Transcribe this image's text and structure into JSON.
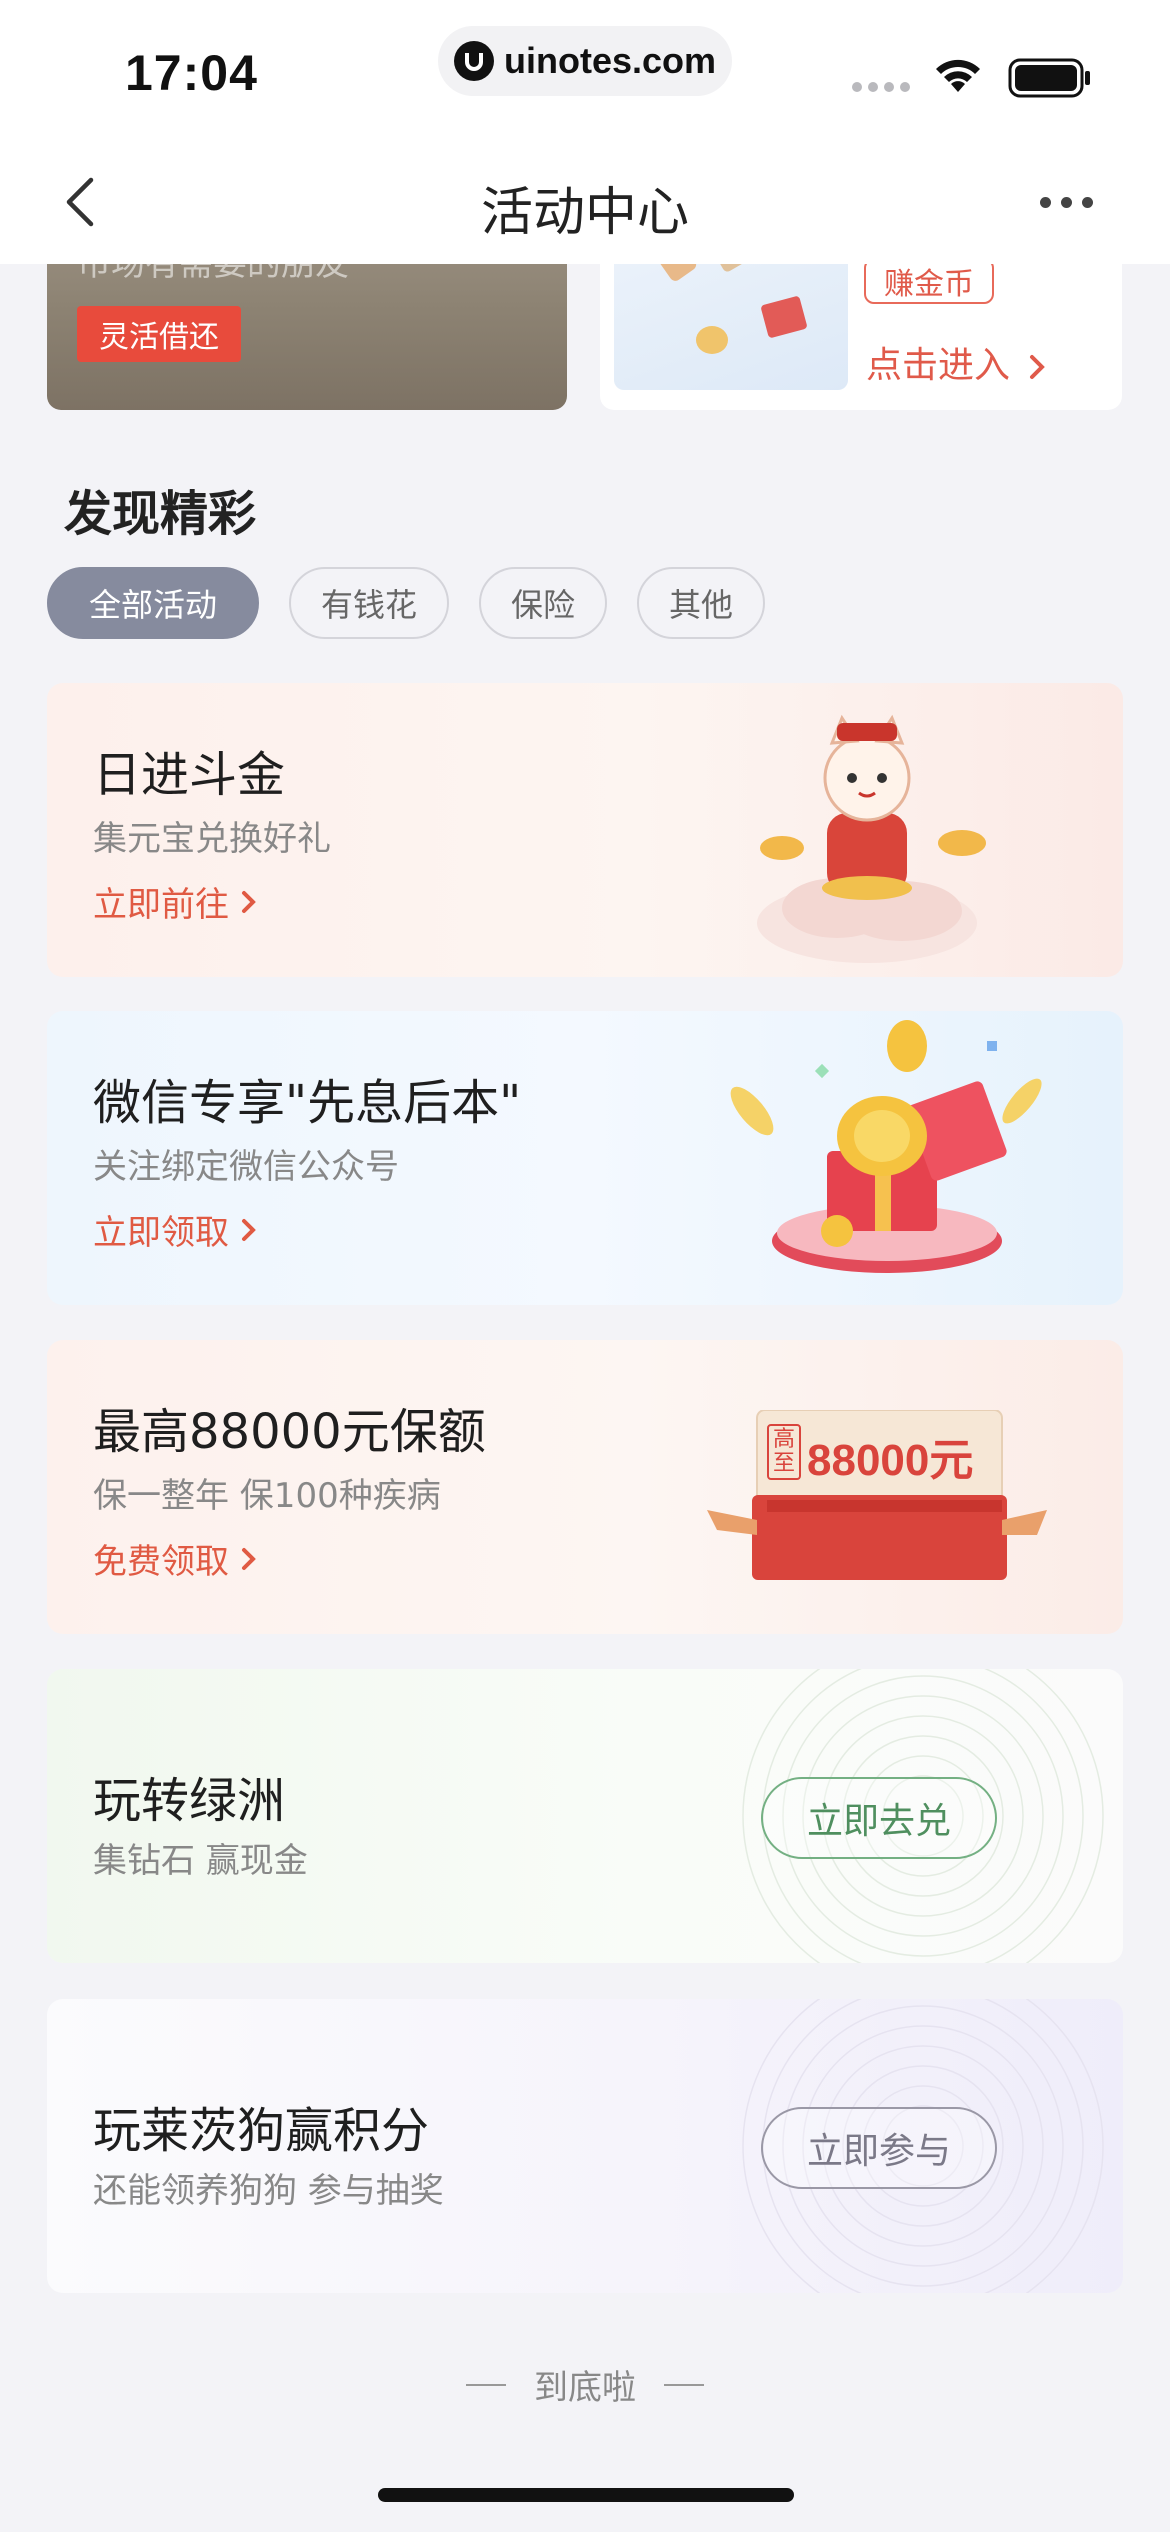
{
  "status_bar": {
    "time": "17:04",
    "url": "uinotes.com"
  },
  "nav": {
    "title": "活动中心"
  },
  "banners": {
    "left": {
      "cut_text": "市场有需要的朋友",
      "tag": "灵活借还"
    },
    "right": {
      "coin_tag": "赚金币",
      "enter": "点击进入"
    }
  },
  "section": {
    "title": "发现精彩",
    "chips": [
      "全部活动",
      "有钱花",
      "保险",
      "其他"
    ]
  },
  "cards": [
    {
      "title": "日进斗金",
      "sub": "集元宝兑换好礼",
      "link": "立即前往"
    },
    {
      "title": "微信专享\"先息后本\"",
      "sub": "关注绑定微信公众号",
      "link": "立即领取"
    },
    {
      "title": "最高88000元保额",
      "sub": "保一整年 保100种疾病",
      "link": "免费领取",
      "gift_small": "高至",
      "gift_amount": "88000元"
    },
    {
      "title": "玩转绿洲",
      "sub": "集钻石 赢现金",
      "button": "立即去兑"
    },
    {
      "title": "玩莱茨狗赢积分",
      "sub": "还能领养狗狗 参与抽奖",
      "button": "立即参与"
    }
  ],
  "footer": {
    "end_text": "到底啦"
  },
  "colors": {
    "accent_red": "#e05a43",
    "chip_active": "#868b9e",
    "green_btn": "#5a9a6a"
  }
}
